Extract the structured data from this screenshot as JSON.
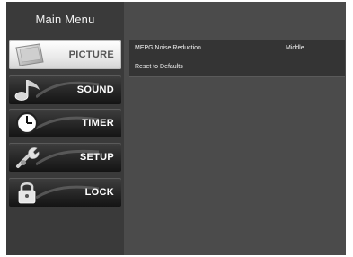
{
  "main_menu": {
    "title": "Main Menu",
    "items": [
      {
        "label": "PICTURE",
        "icon": "picture-icon",
        "selected": true
      },
      {
        "label": "SOUND",
        "icon": "music-note-icon",
        "selected": false
      },
      {
        "label": "TIMER",
        "icon": "clock-icon",
        "selected": false
      },
      {
        "label": "SETUP",
        "icon": "wrench-icon",
        "selected": false
      },
      {
        "label": "LOCK",
        "icon": "padlock-icon",
        "selected": false
      }
    ]
  },
  "submenu": {
    "rows": [
      {
        "label": "MEPG Noise Reduction",
        "value": "Middle"
      },
      {
        "label": "Reset to Defaults",
        "value": ""
      }
    ]
  },
  "colors": {
    "screen_background": "#4b4b4b",
    "sidebar_background": "#3a3a3a",
    "selected_item": "#e9e9e9"
  }
}
